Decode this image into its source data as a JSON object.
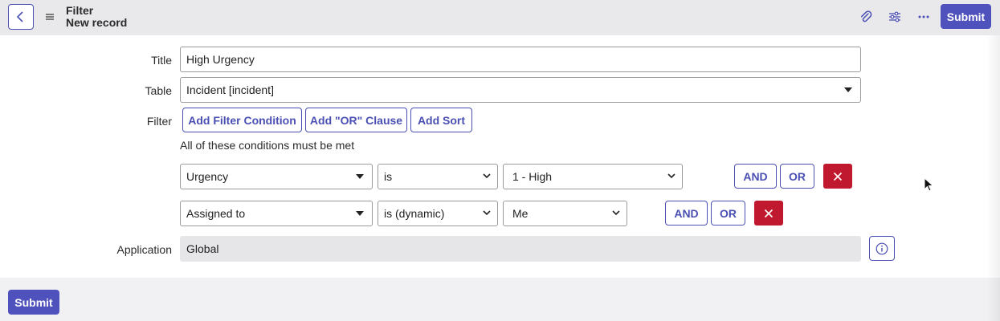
{
  "header": {
    "title": "Filter",
    "subtitle": "New record",
    "submit_label": "Submit"
  },
  "form": {
    "title_label": "Title",
    "title_value": "High Urgency",
    "table_label": "Table",
    "table_value": "Incident [incident]",
    "filter_label": "Filter",
    "filter_buttons": [
      "Add Filter Condition",
      "Add \"OR\" Clause",
      "Add Sort"
    ],
    "conditions_note": "All of these conditions must be met",
    "conditions": [
      {
        "field": "Urgency",
        "operator": "is",
        "value": "1 - High",
        "and_label": "AND",
        "or_label": "OR"
      },
      {
        "field": "Assigned to",
        "operator": "is (dynamic)",
        "value": "Me",
        "and_label": "AND",
        "or_label": "OR"
      }
    ],
    "application_label": "Application",
    "application_value": "Global"
  },
  "footer": {
    "submit_label": "Submit"
  },
  "colors": {
    "accent": "#4f52bd",
    "delete": "#c0182f",
    "header_bg": "#e9e9ec"
  },
  "icons": {
    "back": "chevron-left-icon",
    "menu": "hamburger-icon",
    "attach": "paperclip-icon",
    "settings": "sliders-icon",
    "more": "ellipsis-icon",
    "info": "info-icon",
    "delete": "close-icon"
  }
}
